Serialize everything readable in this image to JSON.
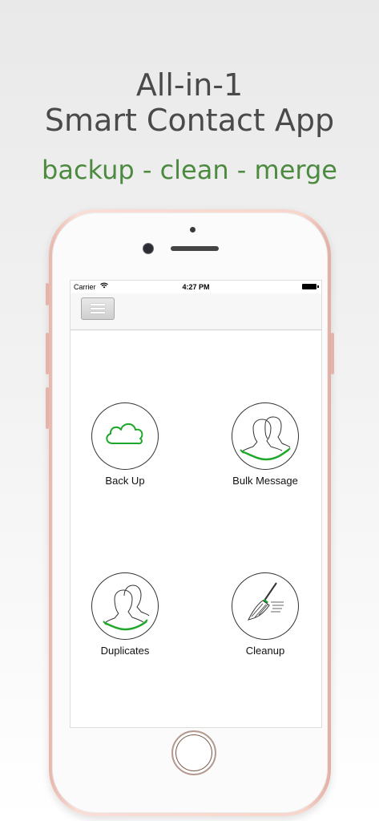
{
  "headline": {
    "line1": "All-in-1",
    "line2": "Smart Contact App"
  },
  "tagline": "backup - clean - merge",
  "status_bar": {
    "carrier": "Carrier",
    "time": "4:27 PM"
  },
  "icons": {
    "menu": "hamburger-menu-icon",
    "wifi": "wifi-icon",
    "battery": "battery-icon"
  },
  "tiles": [
    {
      "label": "Back Up",
      "icon": "cloud-icon"
    },
    {
      "label": "Bulk Message",
      "icon": "group-icon"
    },
    {
      "label": "Duplicates",
      "icon": "duplicate-person-icon"
    },
    {
      "label": "Cleanup",
      "icon": "broom-icon"
    }
  ],
  "colors": {
    "accent": "#4c8a3f",
    "icon_green": "#1fa72a",
    "headline": "#4a4a4a"
  }
}
